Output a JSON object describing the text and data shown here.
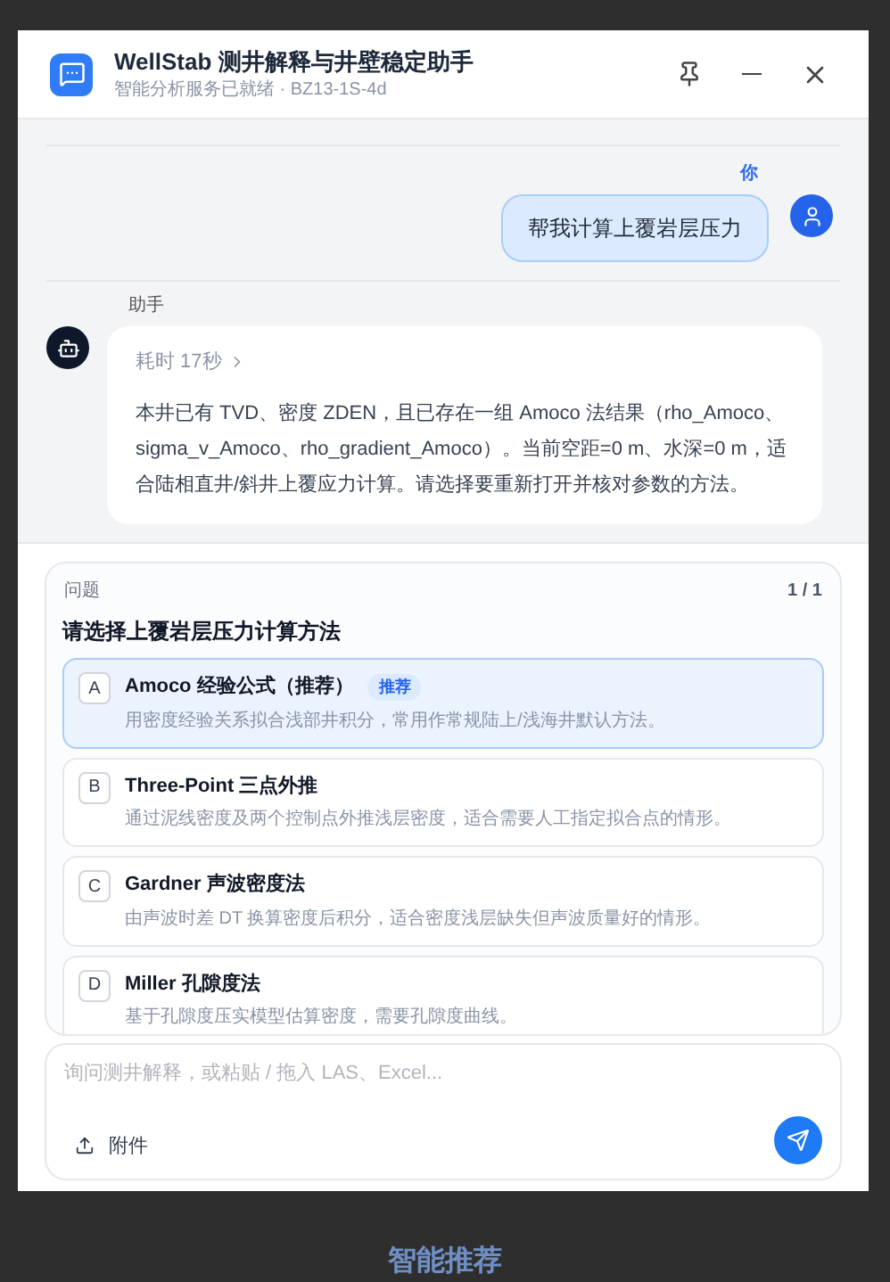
{
  "window": {
    "title": "WellStab 测井解释与井壁稳定助手",
    "subtitle": "智能分析服务已就绪 · BZ13-1S-4d"
  },
  "messages": [
    {
      "kind": "user",
      "author": "你",
      "text": "帮我计算上覆岩层压力"
    },
    {
      "kind": "assistant",
      "author": "助手",
      "elapsed": "耗时 17秒",
      "elapsed_expanded": false,
      "text": "本井已有 TVD、密度 ZDEN，且已存在一组 Amoco 法结果（rho_Amoco、sigma_v_Amoco、rho_gradient_Amoco）。当前空距=0 m、水深=0 m，适合陆相直井/斜井上覆应力计算。请选择要重新打开并核对参数的方法。"
    }
  ],
  "question": {
    "label": "问题",
    "counter": "1 / 1",
    "title": "请选择上覆岩层压力计算方法",
    "options": [
      {
        "letter": "A",
        "title": "Amoco 经验公式（推荐）",
        "badge": "推荐",
        "description": "用密度经验关系拟合浅部井积分，常用作常规陆上/浅海井默认方法。",
        "selected": true
      },
      {
        "letter": "B",
        "title": "Three-Point 三点外推",
        "description": "通过泥线密度及两个控制点外推浅层密度，适合需要人工指定拟合点的情形。",
        "selected": false
      },
      {
        "letter": "C",
        "title": "Gardner 声波密度法",
        "description": "由声波时差 DT 换算密度后积分，适合密度浅层缺失但声波质量好的情形。",
        "selected": false
      },
      {
        "letter": "D",
        "title": "Miller 孔隙度法",
        "description": "基于孔隙度压实模型估算密度，需要孔隙度曲线。",
        "selected": false
      }
    ]
  },
  "composer": {
    "placeholder": "询问测井解释，或粘贴 / 拖入 LAS、Excel...",
    "attach": "附件"
  },
  "caption": "智能推荐"
}
